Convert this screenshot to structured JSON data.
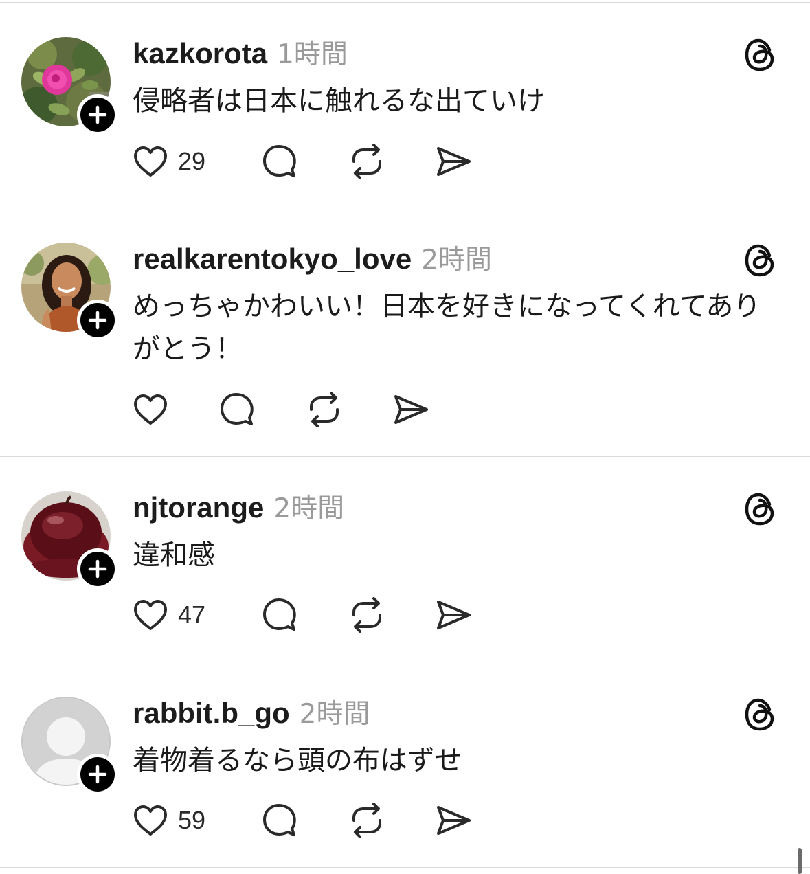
{
  "posts": [
    {
      "username": "kazkorota",
      "time": "1時間",
      "text": "侵略者は日本に触れるな出ていけ",
      "likes": "29",
      "avatar_icon": "rose-photo"
    },
    {
      "username": "realkarentokyo_love",
      "time": "2時間",
      "text": "めっちゃかわいい！日本を好きになってくれてありがとう！",
      "likes": "",
      "avatar_icon": "woman-portrait-photo"
    },
    {
      "username": "njtorange",
      "time": "2時間",
      "text": "違和感",
      "likes": "47",
      "avatar_icon": "red-apple-photo"
    },
    {
      "username": "rabbit.b_go",
      "time": "2時間",
      "text": "着物着るなら頭の布はずせ",
      "likes": "59",
      "avatar_icon": "default-user-silhouette"
    }
  ],
  "icons": {
    "like": "heart-icon",
    "reply": "comment-icon",
    "repost": "repost-icon",
    "share": "send-icon",
    "brand": "threads-logo-icon",
    "follow": "plus-icon"
  },
  "colors": {
    "text": "#1a1a1a",
    "muted": "#9a9a9a",
    "divider": "#d9d9d9",
    "badge": "#000000"
  }
}
